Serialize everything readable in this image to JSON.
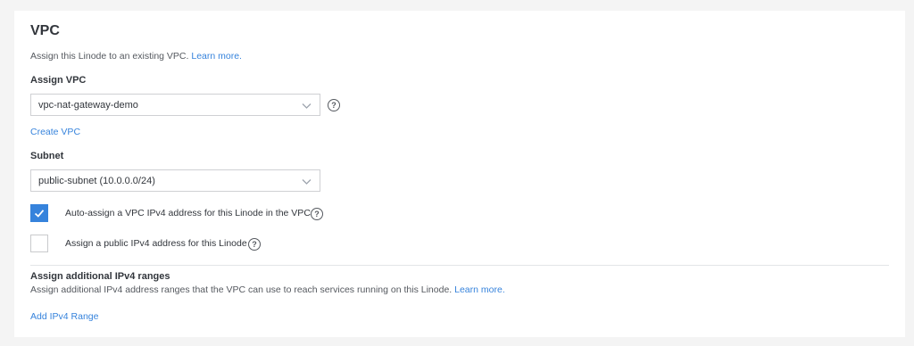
{
  "vpc_section": {
    "title": "VPC",
    "description": "Assign this Linode to an existing VPC.",
    "learn_more": "Learn more.",
    "assign_vpc": {
      "label": "Assign VPC",
      "value": "vpc-nat-gateway-demo",
      "help": "?"
    },
    "create_vpc": "Create VPC",
    "subnet": {
      "label": "Subnet",
      "value": "public-subnet (10.0.0.0/24)"
    },
    "auto_assign": {
      "label": "Auto-assign a VPC IPv4 address for this Linode in the VPC",
      "checked": true,
      "help": "?"
    },
    "public_ipv4": {
      "label": "Assign a public IPv4 address for this Linode",
      "checked": false,
      "help": "?"
    },
    "additional_ranges": {
      "title": "Assign additional IPv4 ranges",
      "description": "Assign additional IPv4 address ranges that the VPC can use to reach services running on this Linode.",
      "learn_more": "Learn more.",
      "add_link": "Add IPv4 Range"
    }
  },
  "colors": {
    "accent": "#3683dc",
    "background": "#f4f4f4",
    "panel": "#ffffff",
    "text": "#32363c"
  }
}
